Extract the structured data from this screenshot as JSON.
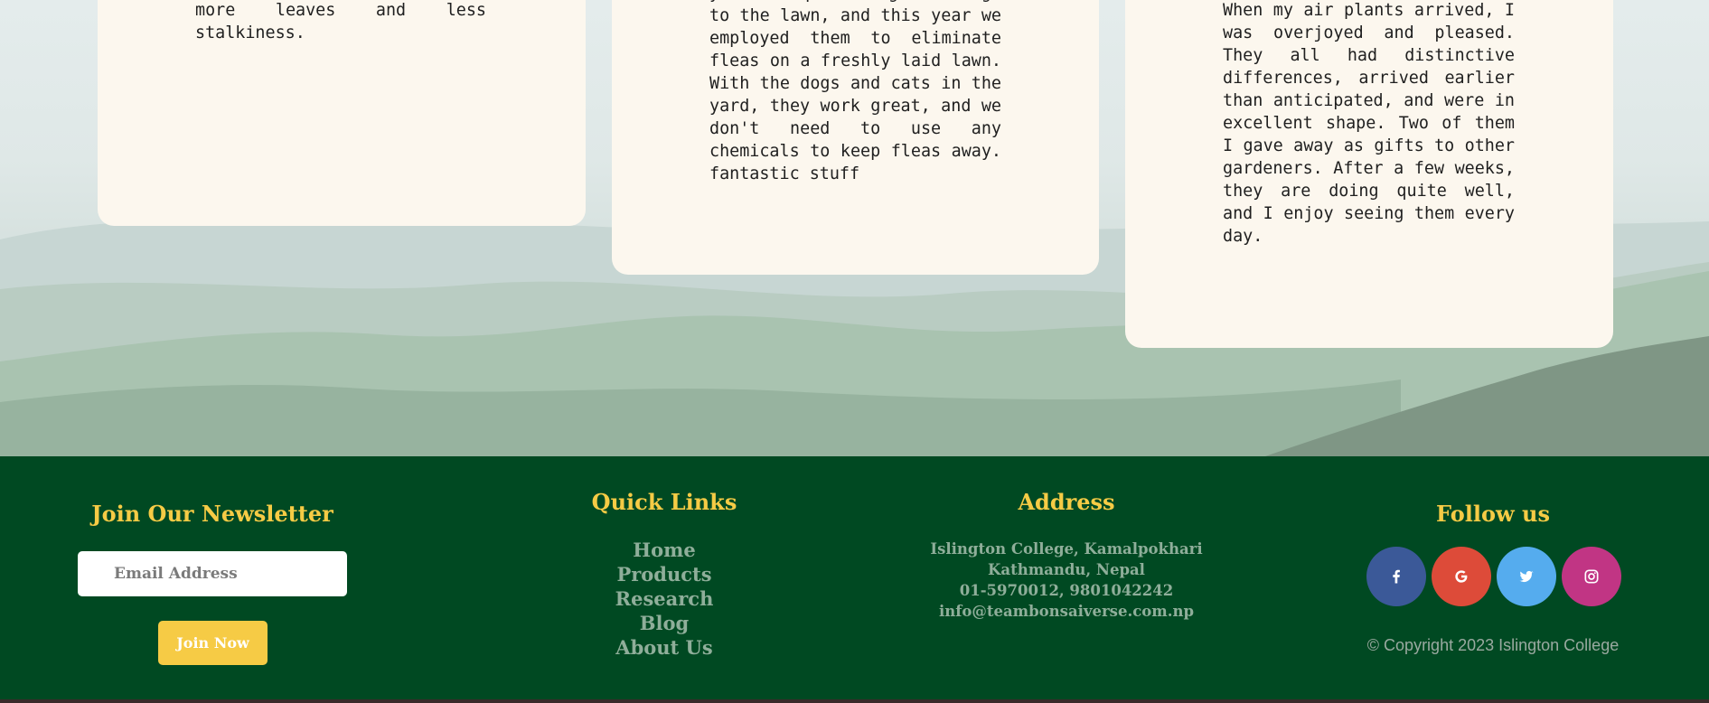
{
  "testimonials": [
    {
      "text": "more leaves and less stalkiness."
    },
    {
      "text": "years to prevent grub damage to the lawn, and this year we employed them to eliminate fleas on a freshly laid lawn. With the dogs and cats in the yard, they work great, and we don't need to use any chemicals to keep fleas away. fantastic stuff"
    },
    {
      "text": "When my air plants arrived, I was overjoyed and pleased. They all had distinctive differences, arrived earlier than anticipated, and were in excellent shape. Two of them I gave away as gifts to other gardeners. After a few weeks, they are doing quite well, and I enjoy seeing them every day."
    }
  ],
  "footer": {
    "newsletter": {
      "title": "Join Our Newsletter",
      "email_placeholder": "Email Address",
      "join_label": "Join Now"
    },
    "quick_links": {
      "title": "Quick Links",
      "items": [
        "Home",
        "Products",
        "Research",
        "Blog",
        "About Us"
      ]
    },
    "address": {
      "title": "Address",
      "lines": [
        "Islington College, Kamalpokhari",
        "Kathmandu, Nepal",
        "01-5970012, 9801042242",
        "info@teambonsaiverse.com.np"
      ]
    },
    "follow": {
      "title": "Follow us",
      "icons": [
        "facebook-icon",
        "google-icon",
        "twitter-icon",
        "instagram-icon"
      ],
      "colors": [
        "#3b5998",
        "#dd4b39",
        "#55acee",
        "#c13584"
      ]
    },
    "copyright": "© Copyright 2023 Islington College"
  },
  "colors": {
    "footer_bg": "#004922",
    "accent": "#f6cb45",
    "link": "#8fae9a",
    "card_bg": "#fcf7ee"
  }
}
